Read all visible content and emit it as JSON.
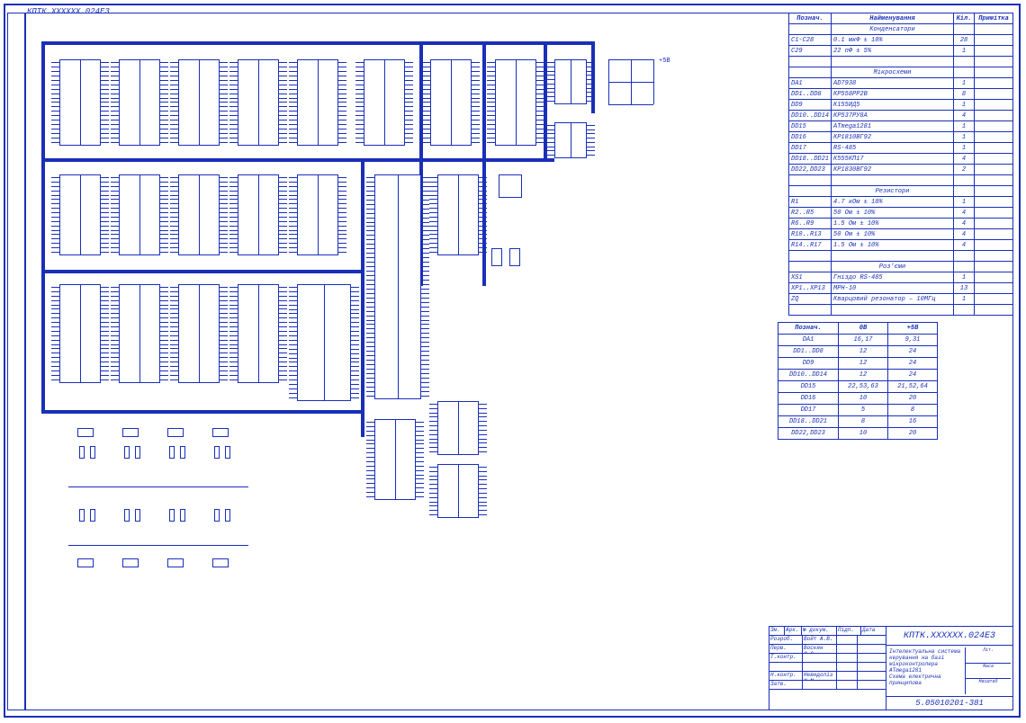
{
  "title_top_left": "КПТК.ХХХХХХ.024Е3",
  "bom": {
    "headers": [
      "Познач.",
      "Найменування",
      "Кіл.",
      "Примітка"
    ],
    "sections": [
      {
        "title": "Конденсатори",
        "rows": [
          [
            "С1-С28",
            "0.1 мкФ ± 10%",
            "28",
            ""
          ],
          [
            "С29",
            "22 пФ ± 5%",
            "1",
            ""
          ]
        ]
      },
      {
        "title": "Мікросхеми",
        "rows": [
          [
            "DA1",
            "AD7938",
            "1",
            ""
          ],
          [
            "DD1..DD8",
            "КР558РР2В",
            "8",
            ""
          ],
          [
            "DD9",
            "К155ИД5",
            "1",
            ""
          ],
          [
            "DD10..DD14",
            "КР537РУ8А",
            "4",
            ""
          ],
          [
            "DD15",
            "ATmega1281",
            "1",
            ""
          ],
          [
            "DD16",
            "КР1810ВГ92",
            "1",
            ""
          ],
          [
            "DD17",
            "RS-485",
            "1",
            ""
          ],
          [
            "DD18..DD21",
            "К555КП17",
            "4",
            ""
          ],
          [
            "DD22,DD23",
            "КР1830ВГ92",
            "2",
            ""
          ]
        ]
      },
      {
        "title": "Резистори",
        "rows": [
          [
            "R1",
            "4.7 кОм ± 10%",
            "1",
            ""
          ],
          [
            "R2..R5",
            "50 Ом ± 10%",
            "4",
            ""
          ],
          [
            "R6..R9",
            "1.5 Ом ± 10%",
            "4",
            ""
          ],
          [
            "R10..R13",
            "50 Ом ± 10%",
            "4",
            ""
          ],
          [
            "R14..R17",
            "1.5 Ом ± 10%",
            "4",
            ""
          ]
        ]
      },
      {
        "title": "Роз'єми",
        "rows": [
          [
            "XS1",
            "Гніздо RS-485",
            "1",
            ""
          ],
          [
            "XP1..XP13",
            "МРН-10",
            "13",
            ""
          ],
          [
            "ZQ",
            "Кварцовий резонатор – 10МГц",
            "1",
            ""
          ]
        ]
      }
    ]
  },
  "power_table": {
    "headers": [
      "Познач.",
      "0В",
      "+5В"
    ],
    "rows": [
      [
        "DA1",
        "16,17",
        "9,31"
      ],
      [
        "DD1..DD8",
        "12",
        "24"
      ],
      [
        "DD9",
        "12",
        "24"
      ],
      [
        "DD10..DD14",
        "12",
        "24"
      ],
      [
        "DD15",
        "22,53,63",
        "21,52,64"
      ],
      [
        "DD16",
        "10",
        "20"
      ],
      [
        "DD17",
        "5",
        "8"
      ],
      [
        "DD18..DD21",
        "8",
        "16"
      ],
      [
        "DD22,DD23",
        "10",
        "20"
      ]
    ]
  },
  "titleblock": {
    "code_top": "КПТК.ХХХХХХ.024Е3",
    "desc_line1": "Інтелектуальна система керування на базі",
    "desc_line2": "мікроконтролера ATmega1281",
    "desc_line3": "Схема електрична принципова",
    "right_labels": [
      "Літ.",
      "Маса",
      "Масштаб"
    ],
    "bottom_code": "5.05010201-381",
    "rev_headers": [
      "Зм.",
      "Арк.",
      "№ докум.",
      "Підп.",
      "Дата"
    ],
    "rev_rows": [
      [
        "Розроб.",
        "Войт А.В.",
        "",
        "",
        ""
      ],
      [
        "Перв.",
        "Воскян О.С.",
        "",
        "",
        ""
      ],
      [
        "Т.контр.",
        "",
        "",
        "",
        ""
      ],
      [
        "",
        "",
        "",
        "",
        ""
      ],
      [
        "Н.контр.",
        "Невидоліз О.М.",
        "",
        "",
        ""
      ],
      [
        "Затв.",
        "",
        "",
        "",
        ""
      ]
    ]
  },
  "schematic_labels": {
    "power": "+5В"
  }
}
